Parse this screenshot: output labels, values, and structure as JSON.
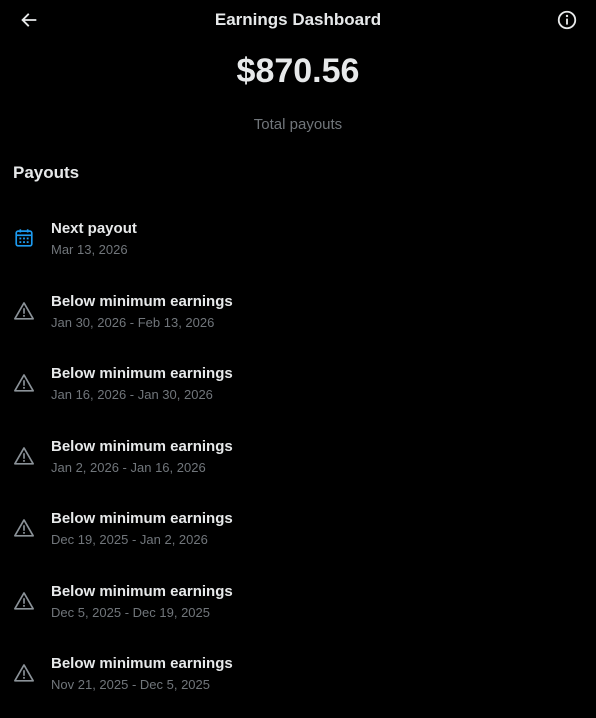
{
  "header": {
    "title": "Earnings Dashboard",
    "back_icon": "arrow-left-icon",
    "info_icon": "info-circle-icon"
  },
  "summary": {
    "amount": "$870.56",
    "label": "Total payouts"
  },
  "payouts": {
    "section_title": "Payouts",
    "items": [
      {
        "icon": "calendar-icon",
        "title": "Next payout",
        "subtitle": "Mar 13, 2026"
      },
      {
        "icon": "warning-icon",
        "title": "Below minimum earnings",
        "subtitle": "Jan 30, 2026 - Feb 13, 2026"
      },
      {
        "icon": "warning-icon",
        "title": "Below minimum earnings",
        "subtitle": "Jan 16, 2026 - Jan 30, 2026"
      },
      {
        "icon": "warning-icon",
        "title": "Below minimum earnings",
        "subtitle": "Jan 2, 2026 - Jan 16, 2026"
      },
      {
        "icon": "warning-icon",
        "title": "Below minimum earnings",
        "subtitle": "Dec 19, 2025 - Jan 2, 2026"
      },
      {
        "icon": "warning-icon",
        "title": "Below minimum earnings",
        "subtitle": "Dec 5, 2025 - Dec 19, 2025"
      },
      {
        "icon": "warning-icon",
        "title": "Below minimum earnings",
        "subtitle": "Nov 21, 2025 - Dec 5, 2025"
      }
    ]
  },
  "colors": {
    "background": "#000000",
    "text_primary": "#e7e9ea",
    "text_secondary": "#71767b",
    "accent": "#1d9bf0"
  }
}
